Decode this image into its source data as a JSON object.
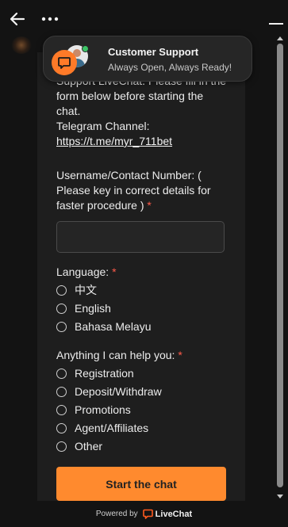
{
  "topbar": {
    "back_icon": "arrow-left-icon",
    "more_icon": "more-dots-icon",
    "minimize_icon": "minimize-icon"
  },
  "header": {
    "title": "Customer Support",
    "subtitle": "Always Open, Always Ready!",
    "accent_color": "#ff7a28",
    "online_color": "#3cc466"
  },
  "intro": {
    "line1": "Support LiveChat. Please fill in the",
    "line2": "form below before starting the",
    "line3": "chat.",
    "telegram_label": "Telegram Channel:",
    "telegram_link": "https://t.me/myr_711bet"
  },
  "username_field": {
    "label_line1": "Username/Contact Number: (",
    "label_line2": "Please key in correct details for",
    "label_line3": "faster procedure )",
    "required_mark": "*",
    "value": ""
  },
  "language": {
    "label": "Language:",
    "required_mark": "*",
    "options": [
      "中文",
      "English",
      "Bahasa Melayu"
    ],
    "selected": null
  },
  "help": {
    "label": "Anything I can help you:",
    "required_mark": "*",
    "options": [
      "Registration",
      "Deposit/Withdraw",
      "Promotions",
      "Agent/Affiliates",
      "Other"
    ],
    "selected": null
  },
  "start_button": {
    "label": "Start the chat",
    "color": "#ff8a2e"
  },
  "footer": {
    "powered_by": "Powered by",
    "brand": "LiveChat"
  }
}
